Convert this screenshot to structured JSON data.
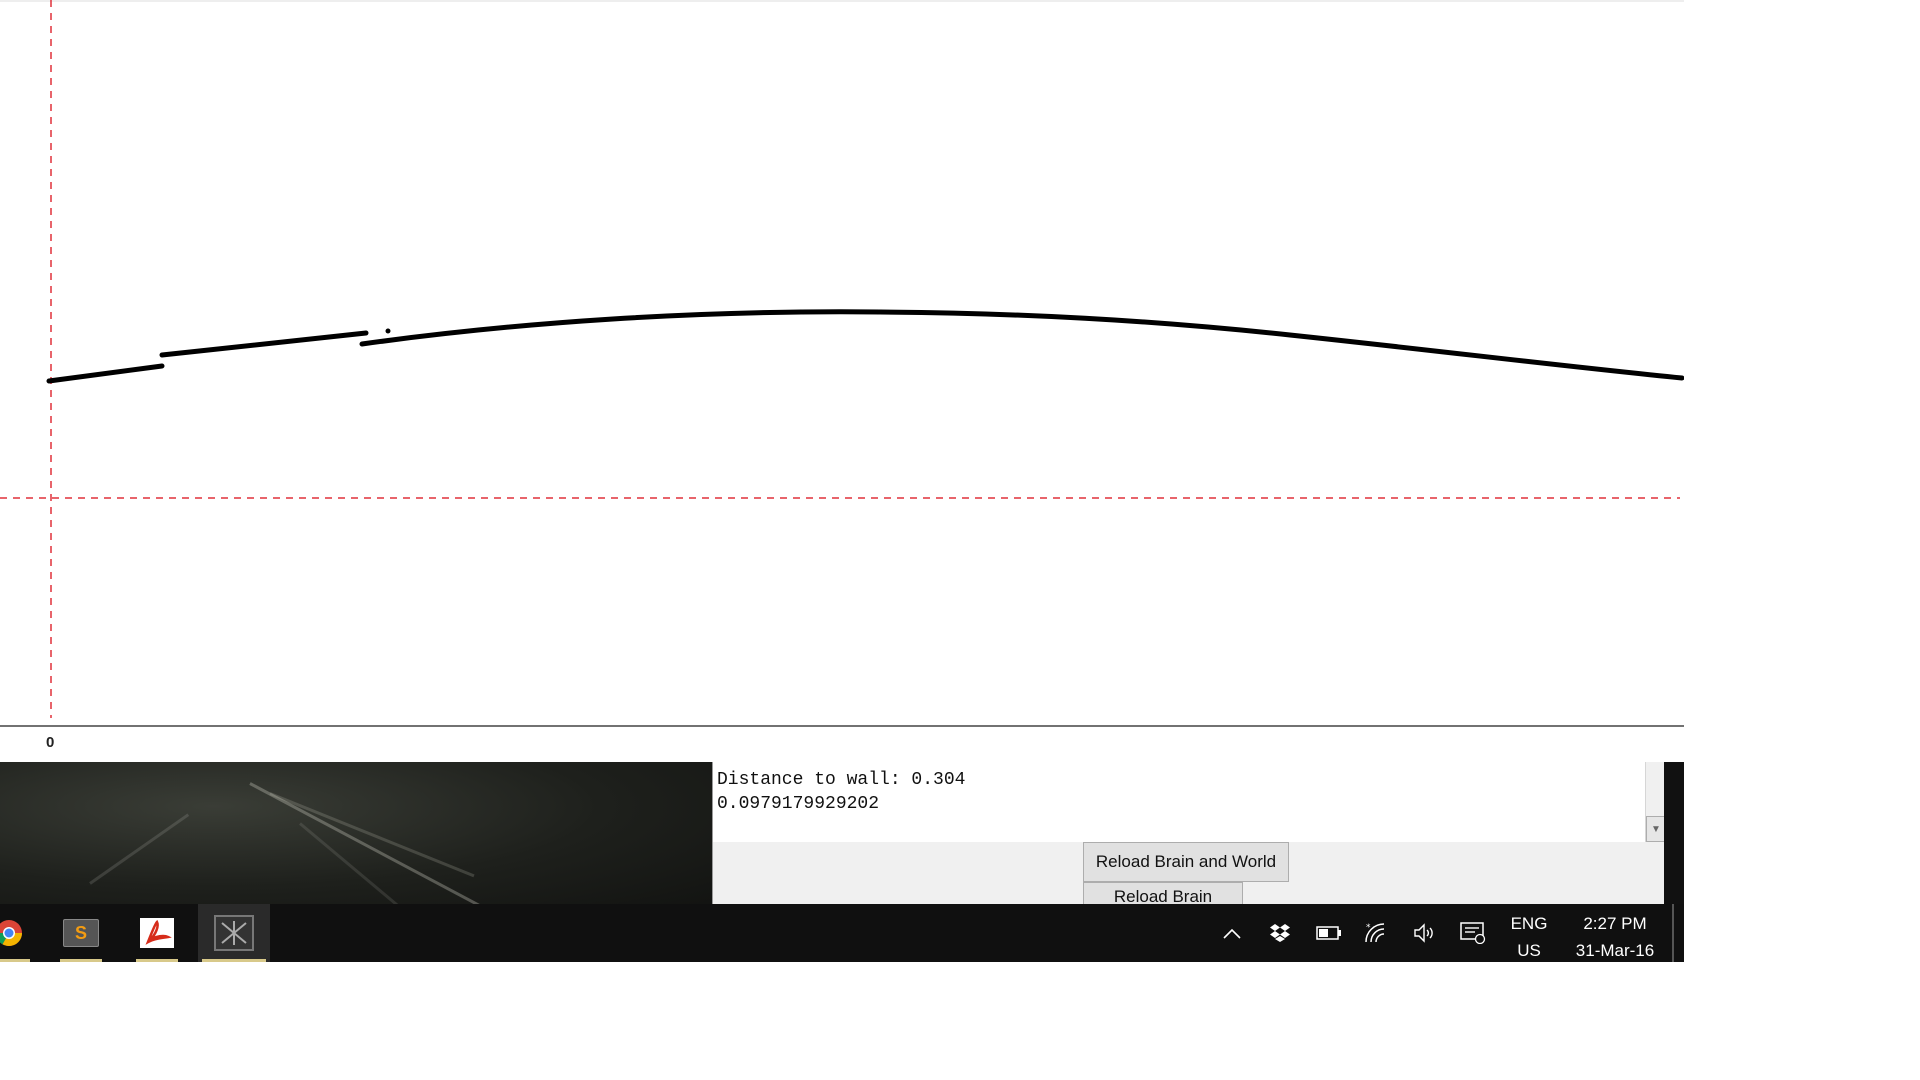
{
  "plot": {
    "axis_zero_label": "0",
    "reference_line_color": "#e0303a",
    "curve_color": "#000000"
  },
  "console": {
    "lines": [
      "Distance to wall: 0.304",
      "0.0979179929202"
    ]
  },
  "buttons": {
    "reload_brain_and_world": "Reload Brain and World",
    "reload_brain": "Reload Brain"
  },
  "taskbar": {
    "apps": [
      {
        "name": "chrome-icon"
      },
      {
        "name": "sublime-text-icon",
        "glyph": "S"
      },
      {
        "name": "acrobat-reader-icon"
      },
      {
        "name": "soar-app-icon"
      }
    ],
    "tray_icons": [
      "chevron-up-icon",
      "dropbox-icon",
      "battery-icon",
      "wifi-icon",
      "volume-icon",
      "notifications-icon"
    ],
    "language_line1": "ENG",
    "language_line2": "US",
    "time": "2:27 PM",
    "date": "31-Mar-16"
  }
}
